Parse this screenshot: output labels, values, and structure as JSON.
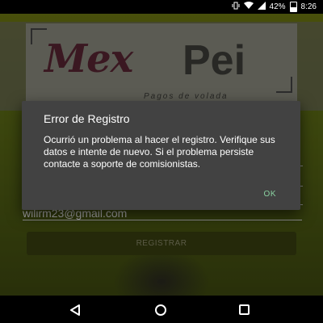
{
  "status_bar": {
    "battery_percent": "42%",
    "time": "8:26",
    "icons": [
      "vibrate-icon",
      "wifi-icon",
      "signal-icon",
      "battery-icon"
    ]
  },
  "app": {
    "logo": {
      "mex": "Mex",
      "pei": "Pei",
      "tagline": "Pagos de volada"
    },
    "email_value": "wilirm23@gmail.com",
    "register_button": "REGISTRAR"
  },
  "dialog": {
    "title": "Error de Registro",
    "message": "Ocurrió un problema al hacer el registro. Verifique sus datos e intente de nuevo. Si el problema persiste contacte a soporte de comisionistas.",
    "ok_label": "OK"
  },
  "colors": {
    "dialog_bg": "#424242",
    "ok_accent": "#89d0a0",
    "app_bg": "#5a6a10"
  }
}
